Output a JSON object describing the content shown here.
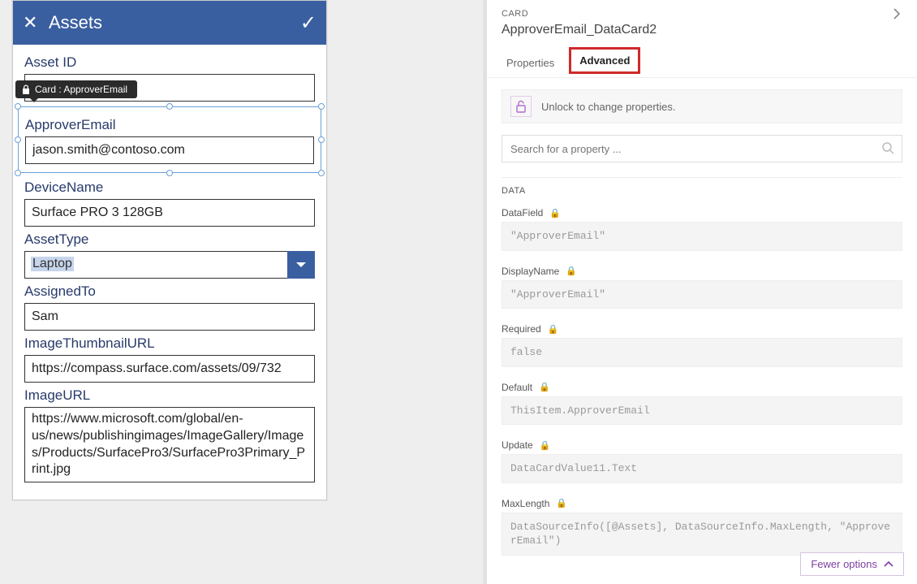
{
  "preview": {
    "headerTitle": "Assets",
    "tooltip": "Card : ApproverEmail",
    "fields": {
      "assetId": {
        "label": "Asset ID",
        "value": ""
      },
      "approverEmail": {
        "label": "ApproverEmail",
        "value": "jason.smith@contoso.com"
      },
      "deviceName": {
        "label": "DeviceName",
        "value": "Surface PRO 3 128GB"
      },
      "assetType": {
        "label": "AssetType",
        "value": "Laptop"
      },
      "assignedTo": {
        "label": "AssignedTo",
        "value": "Sam"
      },
      "thumb": {
        "label": "ImageThumbnailURL",
        "value": "https://compass.surface.com/assets/09/732"
      },
      "imageUrl": {
        "label": "ImageURL",
        "value": "https://www.microsoft.com/global/en-us/news/publishingimages/ImageGallery/Images/Products/SurfacePro3/SurfacePro3Primary_Print.jpg"
      }
    }
  },
  "panel": {
    "kicker": "CARD",
    "title": "ApproverEmail_DataCard2",
    "tabs": {
      "properties": "Properties",
      "advanced": "Advanced"
    },
    "unlockText": "Unlock to change properties.",
    "searchPlaceholder": "Search for a property ...",
    "sectionData": "DATA",
    "props": {
      "dataField": {
        "label": "DataField",
        "value": "\"ApproverEmail\""
      },
      "displayName": {
        "label": "DisplayName",
        "value": "\"ApproverEmail\""
      },
      "required": {
        "label": "Required",
        "value": "false"
      },
      "default": {
        "label": "Default",
        "value": "ThisItem.ApproverEmail"
      },
      "update": {
        "label": "Update",
        "value": "DataCardValue11.Text"
      },
      "maxLength": {
        "label": "MaxLength",
        "value": "DataSourceInfo([@Assets], DataSourceInfo.MaxLength, \"ApproverEmail\")"
      }
    },
    "fewer": "Fewer options"
  }
}
